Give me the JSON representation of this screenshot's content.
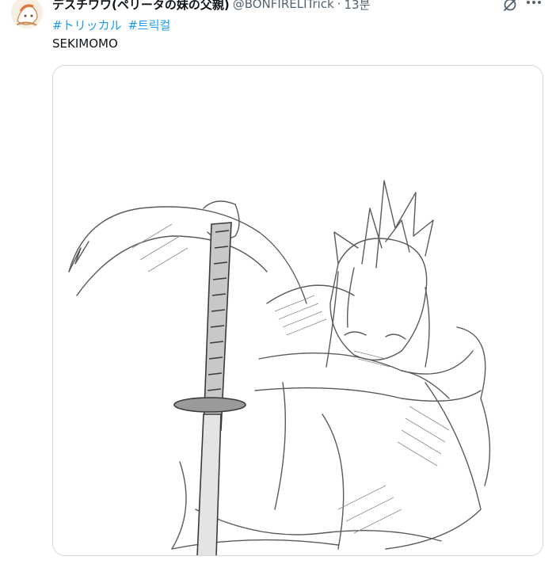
{
  "tweet": {
    "display_name": "デスチワワ(ペリータの妹の父親)",
    "handle": "@BONFIRELITrick",
    "separator": "·",
    "time": "13분",
    "hashtags": [
      "#トリッカル",
      "#트릭컬"
    ],
    "text": "SEKIMOMO"
  },
  "icons": {
    "avatar": "avatar",
    "grok": "grok-icon",
    "more": "more-icon"
  },
  "colors": {
    "link": "#1d9bf0",
    "secondary_text": "#536471",
    "border": "#cfd9de"
  }
}
